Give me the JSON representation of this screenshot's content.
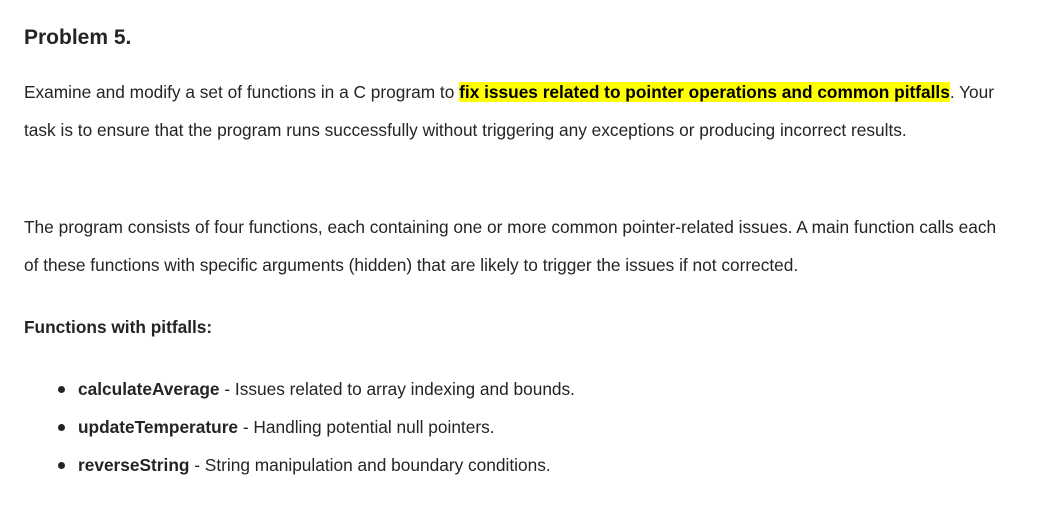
{
  "title": "Problem 5.",
  "paragraph1": {
    "before": "Examine and modify a set of functions in a C program to ",
    "highlight": "fix issues related to pointer operations and common pitfalls",
    "after": ". Your task is to ensure that the program runs successfully without triggering any exceptions or producing incorrect results."
  },
  "paragraph2": "The program consists of four functions, each containing one or more common pointer-related issues. A main function calls each of these functions with specific arguments (hidden) that are likely to trigger the issues if not corrected.",
  "subheading": "Functions with pitfalls:",
  "functions": [
    {
      "name": "calculateAverage",
      "separator": " - ",
      "description": "Issues related to array indexing and bounds."
    },
    {
      "name": "updateTemperature",
      "separator": " - ",
      "description": "Handling potential null pointers."
    },
    {
      "name": "reverseString",
      "separator": " - ",
      "description": "String manipulation and boundary conditions."
    }
  ],
  "colors": {
    "highlight": "#ffff00",
    "text": "#242424"
  }
}
